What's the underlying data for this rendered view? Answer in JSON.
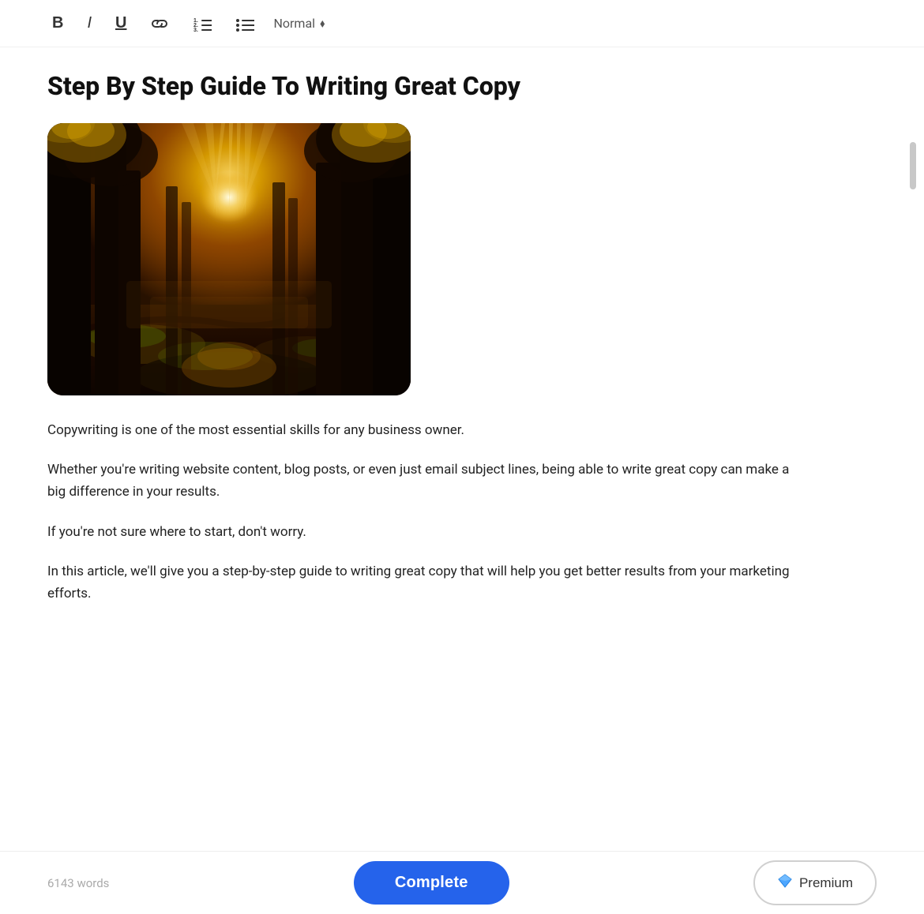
{
  "toolbar": {
    "bold_label": "B",
    "italic_label": "I",
    "underline_label": "U",
    "style_label": "Normal",
    "chevron": "⬦"
  },
  "document": {
    "title": "Step By Step Guide To Writing Great Copy",
    "paragraphs": [
      "Copywriting is one of the most essential skills for any business owner.",
      "Whether you're writing website content, blog posts, or even just email subject lines, being able to write great copy can make a big difference in your results.",
      "If you're not sure where to start, don't worry.",
      "In this article, we'll give you a step-by-step guide to writing great copy that will help you get better results from your marketing efforts."
    ]
  },
  "bottom_bar": {
    "word_count": "6143 words",
    "complete_label": "Complete",
    "premium_label": "Premium"
  }
}
